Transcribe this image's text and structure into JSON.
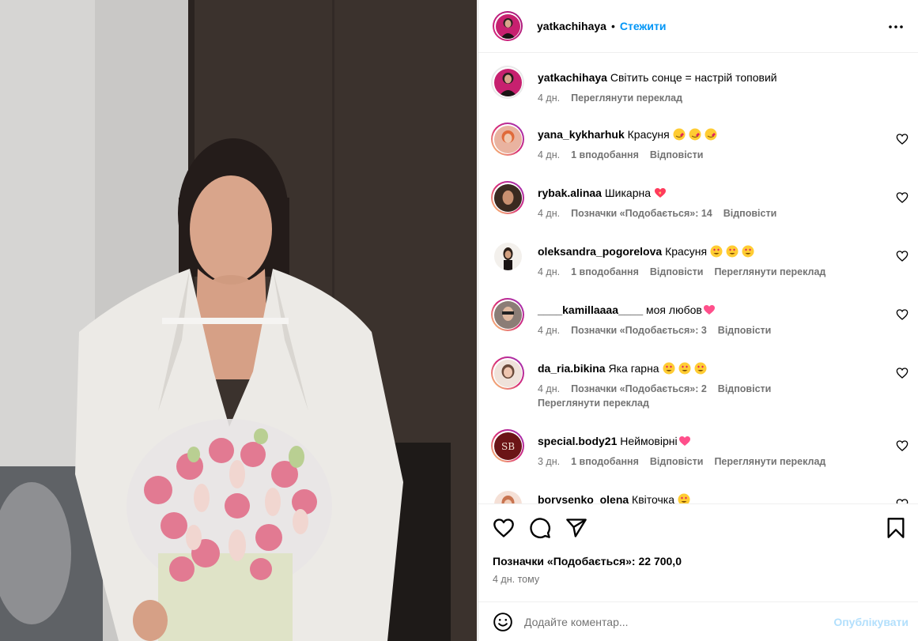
{
  "post": {
    "author": "yatkachihaya",
    "follow_label": "Стежити",
    "dot": "•",
    "caption_user": "yatkachihaya",
    "caption_text": "Світить сонце = настрій топовий",
    "caption_time": "4 дн.",
    "caption_translate": "Переглянути переклад",
    "likes_label": "Позначки «Подобається»: 22 700,0",
    "posted_ago": "4 дн. тому",
    "comment_placeholder": "Додайте коментар...",
    "publish_label": "Опублікувати"
  },
  "comments": [
    {
      "user": "yana_kykharhuk",
      "text": "Красуня",
      "emoji": [
        "hug-heart-emoji",
        "hug-heart-emoji",
        "hug-heart-emoji"
      ],
      "time": "4 дн.",
      "likes": "1 вподобання",
      "reply": "Відповісти",
      "translate": ""
    },
    {
      "user": "rybak.alinaa",
      "text": "Шикарна",
      "emoji": [
        "heart-fire-emoji"
      ],
      "time": "4 дн.",
      "likes": "Позначки «Подобається»: 14",
      "reply": "Відповісти",
      "translate": ""
    },
    {
      "user": "oleksandra_pogorelova",
      "text": "Красуня",
      "emoji": [
        "heart-eyes-emoji",
        "heart-eyes-emoji",
        "heart-eyes-emoji"
      ],
      "time": "4 дн.",
      "likes": "1 вподобання",
      "reply": "Відповісти",
      "translate": "Переглянути переклад"
    },
    {
      "user": "____kamillaaaa____",
      "text": "моя любов",
      "emoji": [
        "pink-heart-emoji"
      ],
      "time": "4 дн.",
      "likes": "Позначки «Подобається»: 3",
      "reply": "Відповісти",
      "translate": ""
    },
    {
      "user": "da_ria.bikina",
      "text": "Яка гарна",
      "emoji": [
        "heart-eyes-emoji",
        "heart-eyes-emoji",
        "heart-eyes-emoji"
      ],
      "time": "4 дн.",
      "likes": "Позначки «Подобається»: 2",
      "reply": "Відповісти",
      "translate": "Переглянути переклад"
    },
    {
      "user": "special.body21",
      "text": "Неймовірні",
      "emoji": [
        "pink-heart-emoji"
      ],
      "time": "3 дн.",
      "likes": "1 вподобання",
      "reply": "Відповісти",
      "translate": "Переглянути переклад"
    },
    {
      "user": "borysenko_olena",
      "text": "Квіточка",
      "emoji": [
        "heart-eyes-emoji"
      ],
      "time": "",
      "likes": "",
      "reply": "",
      "translate": ""
    }
  ],
  "colors": {
    "accent": "#0095f6",
    "publish_disabled": "#b2dffc",
    "muted_text": "#737373"
  }
}
